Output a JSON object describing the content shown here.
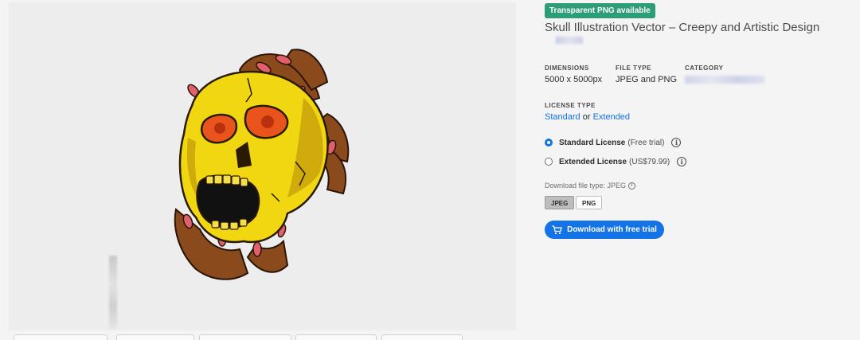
{
  "preview": {
    "image_alt": "Skull illustration",
    "background_color": "#ededed"
  },
  "details": {
    "badge": "Transparent PNG available",
    "title": "Skull Illustration Vector – Creepy and Artistic Design",
    "meta": {
      "dimensions_label": "DIMENSIONS",
      "dimensions_value": "5000 x 5000px",
      "file_type_label": "FILE TYPE",
      "file_type_value": "JPEG and PNG",
      "category_label": "CATEGORY"
    },
    "license": {
      "label": "LICENSE TYPE",
      "standard_link": "Standard",
      "or_text": "or",
      "extended_link": "Extended",
      "options": [
        {
          "name": "Standard License",
          "note": "(Free trial)",
          "selected": true
        },
        {
          "name": "Extended License",
          "note": "(US$79.99)",
          "selected": false
        }
      ]
    },
    "download_type_label": "Download file type: JPEG",
    "formats": [
      {
        "label": "JPEG",
        "active": true
      },
      {
        "label": "PNG",
        "active": false
      }
    ],
    "cta_label": "Download with free trial"
  },
  "colors": {
    "accent": "#1473e6",
    "badge": "#2d9d78"
  },
  "icons": {
    "info": "info-icon",
    "cart": "cart-icon"
  }
}
